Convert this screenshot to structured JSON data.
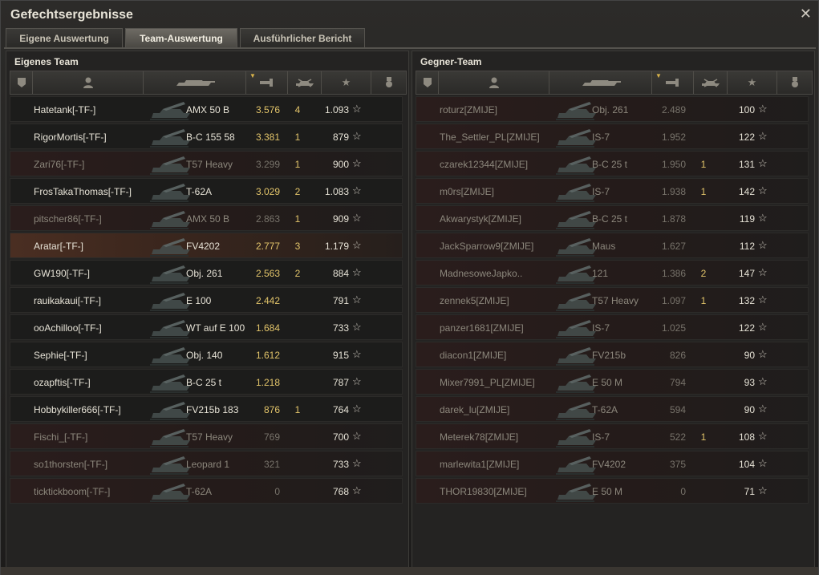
{
  "window": {
    "title": "Gefechtsergebnisse",
    "close_icon": "close-icon"
  },
  "tabs": [
    {
      "label": "Eigene Auswertung",
      "active": false
    },
    {
      "label": "Team-Auswertung",
      "active": true
    },
    {
      "label": "Ausführlicher Bericht",
      "active": false
    }
  ],
  "columns": {
    "icons": [
      "squad-icon",
      "player-icon",
      "tank-icon",
      "xp-icon",
      "kills-icon",
      "damage-star-icon",
      "medal-icon"
    ],
    "sorted_by": "xp"
  },
  "own_team": {
    "title": "Eigenes Team",
    "rows": [
      {
        "name": "Hatetank[-TF-]",
        "tank": "AMX 50 B",
        "xp": "3.576",
        "kills": "4",
        "damage": "1.093",
        "state": "alive"
      },
      {
        "name": "RigorMortis[-TF-]",
        "tank": "B-C 155 58",
        "xp": "3.381",
        "kills": "1",
        "damage": "879",
        "state": "alive"
      },
      {
        "name": "Zari76[-TF-]",
        "tank": "T57 Heavy",
        "xp": "3.299",
        "kills": "1",
        "damage": "900",
        "state": "dead"
      },
      {
        "name": "FrosTakaThomas[-TF-]",
        "tank": "T-62A",
        "xp": "3.029",
        "kills": "2",
        "damage": "1.083",
        "state": "alive"
      },
      {
        "name": "pitscher86[-TF-]",
        "tank": "AMX 50 B",
        "xp": "2.863",
        "kills": "1",
        "damage": "909",
        "state": "dead"
      },
      {
        "name": "Aratar[-TF-]",
        "tank": "FV4202",
        "xp": "2.777",
        "kills": "3",
        "damage": "1.179",
        "state": "highlight"
      },
      {
        "name": "GW190[-TF-]",
        "tank": "Obj. 261",
        "xp": "2.563",
        "kills": "2",
        "damage": "884",
        "state": "alive"
      },
      {
        "name": "rauikakaui[-TF-]",
        "tank": "E 100",
        "xp": "2.442",
        "kills": "",
        "damage": "791",
        "state": "alive"
      },
      {
        "name": "ooAchilloo[-TF-]",
        "tank": "WT auf E 100",
        "xp": "1.684",
        "kills": "",
        "damage": "733",
        "state": "alive"
      },
      {
        "name": "Sephie[-TF-]",
        "tank": "Obj. 140",
        "xp": "1.612",
        "kills": "",
        "damage": "915",
        "state": "alive"
      },
      {
        "name": "ozapftis[-TF-]",
        "tank": "B-C 25 t",
        "xp": "1.218",
        "kills": "",
        "damage": "787",
        "state": "alive"
      },
      {
        "name": "Hobbykiller666[-TF-]",
        "tank": "FV215b 183",
        "xp": "876",
        "kills": "1",
        "damage": "764",
        "state": "alive"
      },
      {
        "name": "Fischi_[-TF-]",
        "tank": "T57 Heavy",
        "xp": "769",
        "kills": "",
        "damage": "700",
        "state": "dead"
      },
      {
        "name": "so1thorsten[-TF-]",
        "tank": "Leopard 1",
        "xp": "321",
        "kills": "",
        "damage": "733",
        "state": "dead"
      },
      {
        "name": "ticktickboom[-TF-]",
        "tank": "T-62A",
        "xp": "0",
        "kills": "",
        "damage": "768",
        "state": "dead"
      }
    ]
  },
  "enemy_team": {
    "title": "Gegner-Team",
    "rows": [
      {
        "name": "roturz[ZMIJE]",
        "tank": "Obj. 261",
        "xp": "2.489",
        "kills": "",
        "damage": "100",
        "state": "dead"
      },
      {
        "name": "The_Settler_PL[ZMIJE]",
        "tank": "IS-7",
        "xp": "1.952",
        "kills": "",
        "damage": "122",
        "state": "dead"
      },
      {
        "name": "czarek12344[ZMIJE]",
        "tank": "B-C 25 t",
        "xp": "1.950",
        "kills": "1",
        "damage": "131",
        "state": "dead"
      },
      {
        "name": "m0rs[ZMIJE]",
        "tank": "IS-7",
        "xp": "1.938",
        "kills": "1",
        "damage": "142",
        "state": "dead"
      },
      {
        "name": "Akwarystyk[ZMIJE]",
        "tank": "B-C 25 t",
        "xp": "1.878",
        "kills": "",
        "damage": "119",
        "state": "dead"
      },
      {
        "name": "JackSparrow9[ZMIJE]",
        "tank": "Maus",
        "xp": "1.627",
        "kills": "",
        "damage": "112",
        "state": "dead"
      },
      {
        "name": "MadnesoweJapko..",
        "tank": "121",
        "xp": "1.386",
        "kills": "2",
        "damage": "147",
        "state": "dead"
      },
      {
        "name": "zennek5[ZMIJE]",
        "tank": "T57 Heavy",
        "xp": "1.097",
        "kills": "1",
        "damage": "132",
        "state": "dead"
      },
      {
        "name": "panzer1681[ZMIJE]",
        "tank": "IS-7",
        "xp": "1.025",
        "kills": "",
        "damage": "122",
        "state": "dead"
      },
      {
        "name": "diacon1[ZMIJE]",
        "tank": "FV215b",
        "xp": "826",
        "kills": "",
        "damage": "90",
        "state": "dead"
      },
      {
        "name": "Mixer7991_PL[ZMIJE]",
        "tank": "E 50 M",
        "xp": "794",
        "kills": "",
        "damage": "93",
        "state": "dead"
      },
      {
        "name": "darek_lu[ZMIJE]",
        "tank": "T-62A",
        "xp": "594",
        "kills": "",
        "damage": "90",
        "state": "dead"
      },
      {
        "name": "Meterek78[ZMIJE]",
        "tank": "IS-7",
        "xp": "522",
        "kills": "1",
        "damage": "108",
        "state": "dead"
      },
      {
        "name": "marlewita1[ZMIJE]",
        "tank": "FV4202",
        "xp": "375",
        "kills": "",
        "damage": "104",
        "state": "dead"
      },
      {
        "name": "THOR19830[ZMIJE]",
        "tank": "E 50 M",
        "xp": "0",
        "kills": "",
        "damage": "71",
        "state": "dead"
      }
    ]
  }
}
